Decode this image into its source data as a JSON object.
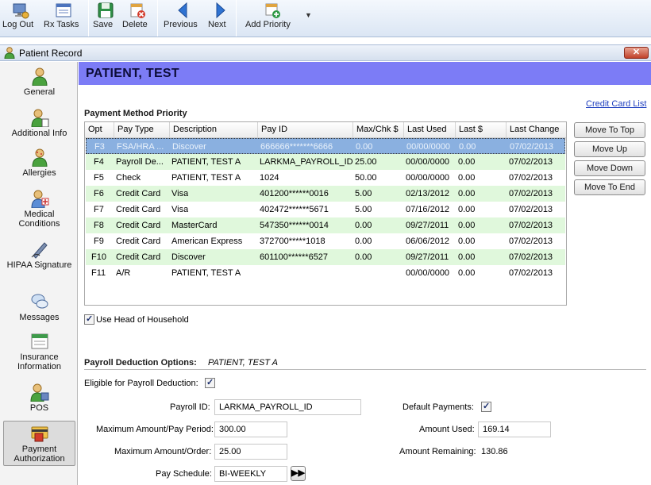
{
  "toolbar": {
    "logout": "Log Out",
    "rx_tasks": "Rx Tasks",
    "save": "Save",
    "delete": "Delete",
    "previous": "Previous",
    "next": "Next",
    "add_priority": "Add Priority"
  },
  "window": {
    "title": "Patient Record",
    "close": "✕"
  },
  "sidebar": {
    "items": [
      {
        "label": "General",
        "icon": "person-icon"
      },
      {
        "label": "Additional Info",
        "icon": "person-info-icon"
      },
      {
        "label": "Allergies",
        "icon": "allergy-icon"
      },
      {
        "label": "Medical Conditions",
        "icon": "medical-icon"
      },
      {
        "label": "HIPAA Signature",
        "icon": "signature-icon"
      },
      {
        "label": "Messages",
        "icon": "messages-icon"
      },
      {
        "label": "Insurance Information",
        "icon": "insurance-icon"
      },
      {
        "label": "POS",
        "icon": "pos-icon"
      },
      {
        "label": "Payment Authorization",
        "icon": "payment-icon"
      }
    ]
  },
  "patient_name": "PATIENT, TEST",
  "payment_method": {
    "title": "Payment Method Priority",
    "credit_card_link": "Credit Card List",
    "columns": [
      "Opt",
      "Pay Type",
      "Description",
      "Pay ID",
      "Max/Chk $",
      "Last Used",
      "Last $",
      "Last Change"
    ],
    "rows": [
      [
        "F3",
        "FSA/HRA ...",
        "Discover",
        "666666*******6666",
        "0.00",
        "00/00/0000",
        "0.00",
        "07/02/2013"
      ],
      [
        "F4",
        "Payroll De...",
        "PATIENT, TEST A",
        "LARKMA_PAYROLL_ID",
        "25.00",
        "00/00/0000",
        "0.00",
        "07/02/2013"
      ],
      [
        "F5",
        "Check",
        "PATIENT, TEST A",
        "1024",
        "50.00",
        "00/00/0000",
        "0.00",
        "07/02/2013"
      ],
      [
        "F6",
        "Credit Card",
        "Visa",
        "401200******0016",
        "5.00",
        "02/13/2012",
        "0.00",
        "07/02/2013"
      ],
      [
        "F7",
        "Credit Card",
        "Visa",
        "402472******5671",
        "5.00",
        "07/16/2012",
        "0.00",
        "07/02/2013"
      ],
      [
        "F8",
        "Credit Card",
        "MasterCard",
        "547350******0014",
        "0.00",
        "09/27/2011",
        "0.00",
        "07/02/2013"
      ],
      [
        "F9",
        "Credit Card",
        "American Express",
        "372700*****1018",
        "0.00",
        "06/06/2012",
        "0.00",
        "07/02/2013"
      ],
      [
        "F10",
        "Credit Card",
        "Discover",
        "601100******6527",
        "0.00",
        "09/27/2011",
        "0.00",
        "07/02/2013"
      ],
      [
        "F11",
        "A/R",
        "PATIENT, TEST A",
        "",
        "",
        "00/00/0000",
        "0.00",
        "07/02/2013"
      ]
    ],
    "buttons": {
      "move_to_top": "Move To Top",
      "move_up": "Move Up",
      "move_down": "Move Down",
      "move_to_end": "Move To End"
    },
    "use_head_of_household": "Use Head of Household"
  },
  "payroll": {
    "title": "Payroll Deduction Options:",
    "patient": "PATIENT, TEST A",
    "eligible_label": "Eligible for Payroll Deduction:",
    "payroll_id_label": "Payroll ID:",
    "payroll_id": "LARKMA_PAYROLL_ID",
    "max_per_period_label": "Maximum Amount/Pay Period:",
    "max_per_period": "300.00",
    "max_per_order_label": "Maximum Amount/Order:",
    "max_per_order": "25.00",
    "pay_schedule_label": "Pay Schedule:",
    "pay_schedule": "BI-WEEKLY",
    "default_payments_label": "Default Payments:",
    "amount_used_label": "Amount Used:",
    "amount_used": "169.14",
    "amount_remaining_label": "Amount Remaining:",
    "amount_remaining": "130.86",
    "ff_button": "▶▶"
  }
}
